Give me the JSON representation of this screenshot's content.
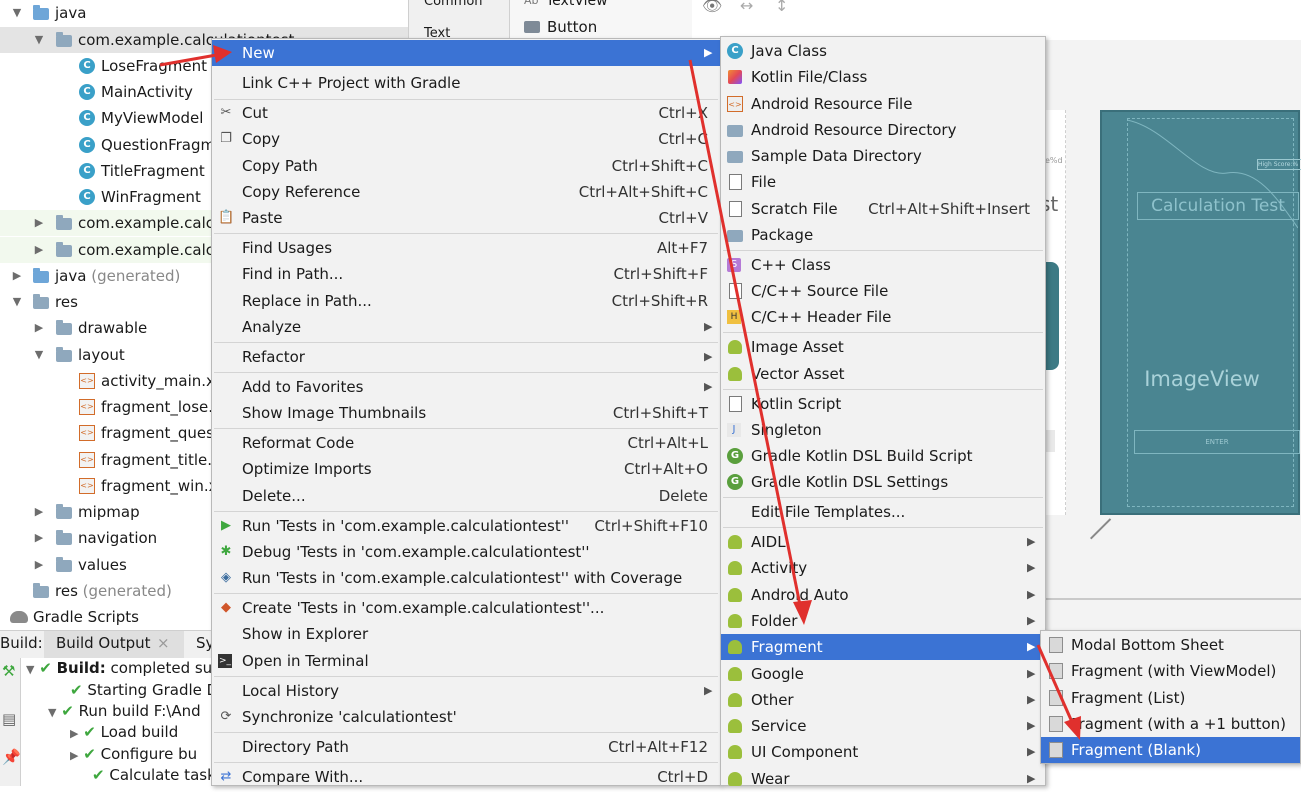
{
  "tree": {
    "items": [
      {
        "label": "java",
        "gen": ""
      },
      {
        "label": "com.example.calculationtest",
        "gen": ""
      },
      {
        "label": "LoseFragment",
        "gen": ""
      },
      {
        "label": "MainActivity",
        "gen": ""
      },
      {
        "label": "MyViewModel",
        "gen": ""
      },
      {
        "label": "QuestionFragment",
        "gen": ""
      },
      {
        "label": "TitleFragment",
        "gen": ""
      },
      {
        "label": "WinFragment",
        "gen": ""
      },
      {
        "label": "com.example.calculationtest",
        "gen": ""
      },
      {
        "label": "com.example.calculationtest",
        "gen": ""
      },
      {
        "label": "java",
        "gen": "(generated)"
      },
      {
        "label": "res",
        "gen": ""
      },
      {
        "label": "drawable",
        "gen": ""
      },
      {
        "label": "layout",
        "gen": ""
      },
      {
        "label": "activity_main.xml",
        "gen": ""
      },
      {
        "label": "fragment_lose.xml",
        "gen": ""
      },
      {
        "label": "fragment_question.xml",
        "gen": ""
      },
      {
        "label": "fragment_title.xml",
        "gen": ""
      },
      {
        "label": "fragment_win.xml",
        "gen": ""
      },
      {
        "label": "mipmap",
        "gen": ""
      },
      {
        "label": "navigation",
        "gen": ""
      },
      {
        "label": "values",
        "gen": ""
      },
      {
        "label": "res",
        "gen": "(generated)"
      },
      {
        "label": "Gradle Scripts",
        "gen": ""
      }
    ]
  },
  "palette": {
    "common": "Common",
    "text": "Text",
    "textview": "TextView",
    "ab": "Ab",
    "button": "Button"
  },
  "preview": {
    "title": "Calculation Test",
    "image": "ImageView",
    "enter": "ENTER",
    "score": "High Score:%",
    "st": "st"
  },
  "build": {
    "tab_build": "Build:",
    "tab_output": "Build Output",
    "tab_sync": "Sy",
    "lines": [
      {
        "bold": "Build:",
        "text": " completed su"
      },
      {
        "bold": "",
        "text": "Starting Gradle D"
      },
      {
        "bold": "",
        "text": "Run build F:\\And"
      },
      {
        "bold": "",
        "text": "Load build"
      },
      {
        "bold": "",
        "text": "Configure bu"
      },
      {
        "bold": "",
        "text": "Calculate task"
      }
    ]
  },
  "context_menu": {
    "items": [
      {
        "label": "New",
        "shortcut": ""
      },
      {
        "label": "Link C++ Project with Gradle",
        "shortcut": ""
      },
      {
        "label": "Cut",
        "shortcut": "Ctrl+X"
      },
      {
        "label": "Copy",
        "shortcut": "Ctrl+C"
      },
      {
        "label": "Copy Path",
        "shortcut": "Ctrl+Shift+C"
      },
      {
        "label": "Copy Reference",
        "shortcut": "Ctrl+Alt+Shift+C"
      },
      {
        "label": "Paste",
        "shortcut": "Ctrl+V"
      },
      {
        "label": "Find Usages",
        "shortcut": "Alt+F7"
      },
      {
        "label": "Find in Path...",
        "shortcut": "Ctrl+Shift+F"
      },
      {
        "label": "Replace in Path...",
        "shortcut": "Ctrl+Shift+R"
      },
      {
        "label": "Analyze",
        "shortcut": ""
      },
      {
        "label": "Refactor",
        "shortcut": ""
      },
      {
        "label": "Add to Favorites",
        "shortcut": ""
      },
      {
        "label": "Show Image Thumbnails",
        "shortcut": "Ctrl+Shift+T"
      },
      {
        "label": "Reformat Code",
        "shortcut": "Ctrl+Alt+L"
      },
      {
        "label": "Optimize Imports",
        "shortcut": "Ctrl+Alt+O"
      },
      {
        "label": "Delete...",
        "shortcut": "Delete"
      },
      {
        "label": "Run 'Tests in 'com.example.calculationtest''",
        "shortcut": "Ctrl+Shift+F10"
      },
      {
        "label": "Debug 'Tests in 'com.example.calculationtest''",
        "shortcut": ""
      },
      {
        "label": "Run 'Tests in 'com.example.calculationtest'' with Coverage",
        "shortcut": ""
      },
      {
        "label": "Create 'Tests in 'com.example.calculationtest''...",
        "shortcut": ""
      },
      {
        "label": "Show in Explorer",
        "shortcut": ""
      },
      {
        "label": "Open in Terminal",
        "shortcut": ""
      },
      {
        "label": "Local History",
        "shortcut": ""
      },
      {
        "label": "Synchronize 'calculationtest'",
        "shortcut": ""
      },
      {
        "label": "Directory Path",
        "shortcut": "Ctrl+Alt+F12"
      },
      {
        "label": "Compare With...",
        "shortcut": "Ctrl+D"
      }
    ]
  },
  "new_menu": {
    "items": [
      {
        "label": "Java Class",
        "shortcut": ""
      },
      {
        "label": "Kotlin File/Class",
        "shortcut": ""
      },
      {
        "label": "Android Resource File",
        "shortcut": ""
      },
      {
        "label": "Android Resource Directory",
        "shortcut": ""
      },
      {
        "label": "Sample Data Directory",
        "shortcut": ""
      },
      {
        "label": "File",
        "shortcut": ""
      },
      {
        "label": "Scratch File",
        "shortcut": "Ctrl+Alt+Shift+Insert"
      },
      {
        "label": "Package",
        "shortcut": ""
      },
      {
        "label": "C++ Class",
        "shortcut": ""
      },
      {
        "label": "C/C++ Source File",
        "shortcut": ""
      },
      {
        "label": "C/C++ Header File",
        "shortcut": ""
      },
      {
        "label": "Image Asset",
        "shortcut": ""
      },
      {
        "label": "Vector Asset",
        "shortcut": ""
      },
      {
        "label": "Kotlin Script",
        "shortcut": ""
      },
      {
        "label": "Singleton",
        "shortcut": ""
      },
      {
        "label": "Gradle Kotlin DSL Build Script",
        "shortcut": ""
      },
      {
        "label": "Gradle Kotlin DSL Settings",
        "shortcut": ""
      },
      {
        "label": "Edit File Templates...",
        "shortcut": ""
      },
      {
        "label": "AIDL",
        "shortcut": ""
      },
      {
        "label": "Activity",
        "shortcut": ""
      },
      {
        "label": "Android Auto",
        "shortcut": ""
      },
      {
        "label": "Folder",
        "shortcut": ""
      },
      {
        "label": "Fragment",
        "shortcut": ""
      },
      {
        "label": "Google",
        "shortcut": ""
      },
      {
        "label": "Other",
        "shortcut": ""
      },
      {
        "label": "Service",
        "shortcut": ""
      },
      {
        "label": "UI Component",
        "shortcut": ""
      },
      {
        "label": "Wear",
        "shortcut": ""
      }
    ]
  },
  "fragment_menu": {
    "items": [
      {
        "label": "Modal Bottom Sheet"
      },
      {
        "label": "Fragment (with ViewModel)"
      },
      {
        "label": "Fragment (List)"
      },
      {
        "label": "Fragment (with a +1 button)"
      },
      {
        "label": "Fragment (Blank)"
      }
    ]
  },
  "colors": {
    "highlight": "#3b73d4",
    "annotation_arrow": "#e0302d",
    "blueprint": "#4a8591"
  }
}
